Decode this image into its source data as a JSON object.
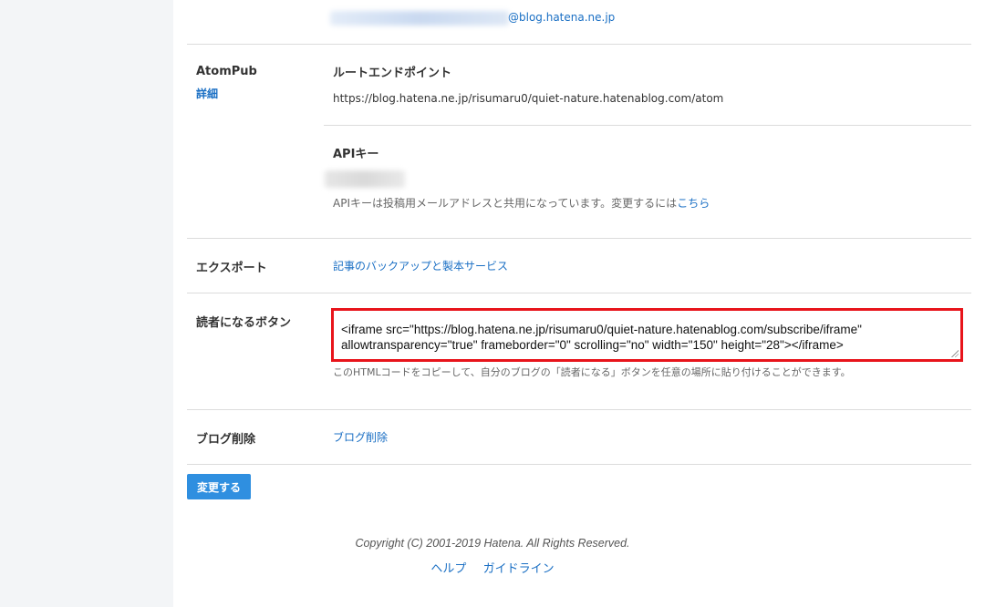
{
  "email": {
    "suffix": "@blog.hatena.ne.jp"
  },
  "atompub": {
    "label": "AtomPub",
    "detail_link": "詳細",
    "root_endpoint_heading": "ルートエンドポイント",
    "root_endpoint_url": "https://blog.hatena.ne.jp/risumaru0/quiet-nature.hatenablog.com/atom",
    "api_key_heading": "APIキー",
    "api_key_note": "APIキーは投稿用メールアドレスと共用になっています。変更するには",
    "api_key_change_link": "こちら"
  },
  "export": {
    "label": "エクスポート",
    "link": "記事のバックアップと製本サービス"
  },
  "subscribe_button": {
    "label": "読者になるボタン",
    "code": "<iframe src=\"https://blog.hatena.ne.jp/risumaru0/quiet-nature.hatenablog.com/subscribe/iframe\" allowtransparency=\"true\" frameborder=\"0\" scrolling=\"no\" width=\"150\" height=\"28\"></iframe>",
    "note": "このHTMLコードをコピーして、自分のブログの「読者になる」ボタンを任意の場所に貼り付けることができます。"
  },
  "delete_blog": {
    "label": "ブログ削除",
    "link": "ブログ削除"
  },
  "submit_label": "変更する",
  "footer": {
    "copyright": "Copyright (C) 2001-2019 Hatena. All Rights Reserved.",
    "help": "ヘルプ",
    "guideline": "ガイドライン"
  },
  "colors": {
    "link": "#1a6fc4",
    "button": "#2f8fe0",
    "highlight_border": "#e8141b"
  }
}
